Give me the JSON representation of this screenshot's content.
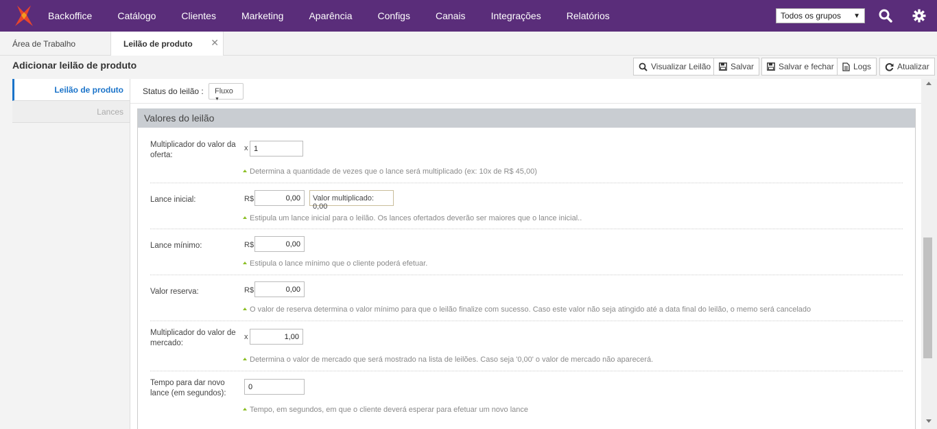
{
  "nav": {
    "items": [
      "Backoffice",
      "Catálogo",
      "Clientes",
      "Marketing",
      "Aparência",
      "Configs",
      "Canais",
      "Integrações",
      "Relatórios"
    ],
    "group_select": "Todos os grupos",
    "brand_color": "#5a2d7a"
  },
  "tabs": [
    {
      "label": "Área de Trabalho"
    },
    {
      "label": "Leilão de produto"
    }
  ],
  "header": {
    "title": "Adicionar leilão de produto",
    "buttons": {
      "view": "Visualizar Leilão",
      "save": "Salvar",
      "save_close": "Salvar e fechar",
      "logs": "Logs",
      "refresh": "Atualizar"
    }
  },
  "sidebar": {
    "items": [
      {
        "label": "Leilão de produto"
      },
      {
        "label": "Lances"
      }
    ]
  },
  "status": {
    "label": "Status do leilão :",
    "value": "Fluxo"
  },
  "section": {
    "title": "Valores do leilão",
    "fields": [
      {
        "label": "Multiplicador do valor da oferta:",
        "prefix": "x",
        "value": "1",
        "hint": "Determina a quantidade de vezes que o lance será multiplicado (ex: 10x de R$ 45,00)"
      },
      {
        "label": "Lance inicial:",
        "prefix": "R$",
        "value": "0,00",
        "extra": "Valor multiplicado: 0,00",
        "hint": "Estipula um lance inicial para o leilão. Os lances ofertados deverão ser maiores que o lance inicial.."
      },
      {
        "label": "Lance mínimo:",
        "prefix": "R$",
        "value": "0,00",
        "hint": "Estipula o lance mínimo que o cliente poderá efetuar."
      },
      {
        "label": "Valor reserva:",
        "prefix": "R$",
        "value": "0,00",
        "hint": "O valor de reserva determina o valor mínimo para que o leilão finalize com sucesso. Caso este valor não seja atingido até a data final do leilão, o memo será cancelado"
      },
      {
        "label": "Multiplicador do valor de mercado:",
        "prefix": "x",
        "value": "1,00",
        "hint": "Determina o valor de mercado que será mostrado na lista de leilões. Caso seja '0,00' o valor de mercado não aparecerá."
      },
      {
        "label": "Tempo para dar novo lance (em segundos):",
        "value": "0",
        "hint": "Tempo, em segundos, em que o cliente deverá esperar para efetuar um novo lance"
      }
    ]
  }
}
